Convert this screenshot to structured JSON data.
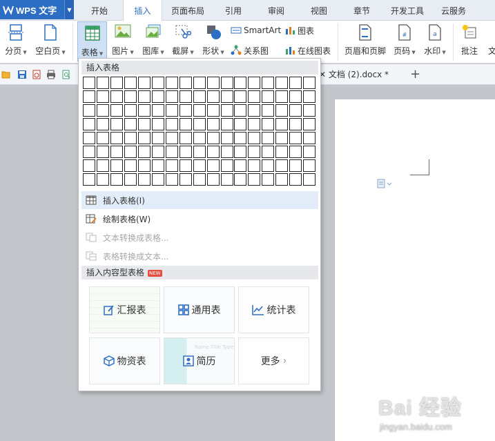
{
  "app": {
    "title": "WPS 文字"
  },
  "tabs": [
    {
      "label": "开始"
    },
    {
      "label": "插入"
    },
    {
      "label": "页面布局"
    },
    {
      "label": "引用"
    },
    {
      "label": "审阅"
    },
    {
      "label": "视图"
    },
    {
      "label": "章节"
    },
    {
      "label": "开发工具"
    },
    {
      "label": "云服务"
    }
  ],
  "active_tab": "插入",
  "ribbon": {
    "page_break": "分页",
    "blank_page": "空白页",
    "table": "表格",
    "picture": "图片",
    "gallery": "图库",
    "screenshot": "截屏",
    "shape": "形状",
    "smartart": "SmartArt",
    "chart": "图表",
    "relation_chart": "关系图",
    "online_chart": "在线图表",
    "header_footer": "页眉和页脚",
    "page_number": "页码",
    "watermark": "水印",
    "comment": "批注",
    "cut_text": "文"
  },
  "document_tab": {
    "name": "文档 (2).docx *"
  },
  "dropdown": {
    "insert_table_header": "插入表格",
    "grid_cols": 17,
    "grid_rows": 8,
    "items": [
      {
        "label": "插入表格(I)",
        "enabled": true
      },
      {
        "label": "绘制表格(W)",
        "enabled": true
      },
      {
        "label": "文本转换成表格...",
        "enabled": false
      },
      {
        "label": "表格转换成文本...",
        "enabled": false
      }
    ],
    "content_tables_header": "插入内容型表格",
    "new_badge": "NEW",
    "templates": [
      {
        "label": "汇报表",
        "icon": "report-edit-icon"
      },
      {
        "label": "通用表",
        "icon": "grid-four-icon"
      },
      {
        "label": "统计表",
        "icon": "line-chart-icon"
      },
      {
        "label": "物资表",
        "icon": "cube-icon"
      },
      {
        "label": "简历",
        "icon": "id-card-icon"
      },
      {
        "label": "更多",
        "icon": "chevron-right-icon"
      }
    ],
    "faint_template_text": "Name Title Type"
  },
  "watermark": {
    "brand": "Bai 经验",
    "url": "jingyan.baidu.com"
  },
  "colors": {
    "accent": "#2d6ec5",
    "highlight": "#e3edf9",
    "new_badge": "#e74c3c"
  }
}
